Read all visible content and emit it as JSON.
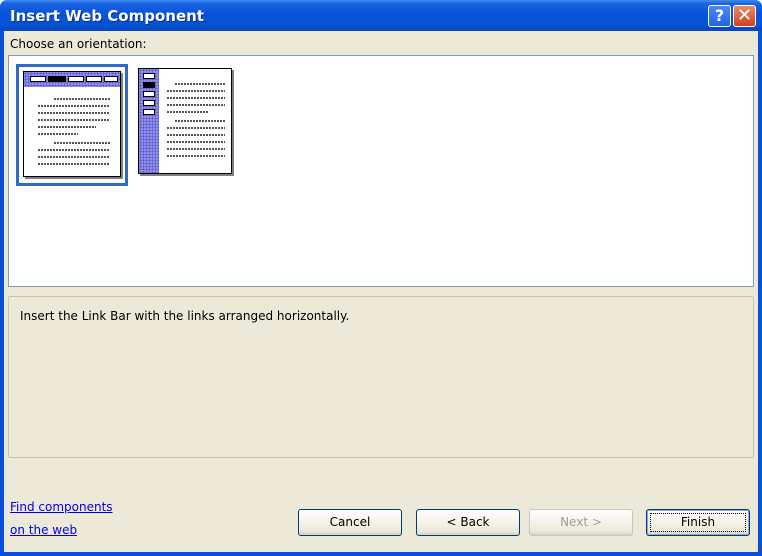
{
  "window": {
    "title": "Insert Web Component"
  },
  "titlebar_buttons": {
    "help": "?",
    "close": "✕"
  },
  "orientation": {
    "label": "Choose an orientation:",
    "selected": "horizontal",
    "options": [
      "horizontal",
      "vertical"
    ]
  },
  "description": "Insert the Link Bar with the links arranged horizontally.",
  "links": {
    "line1": "Find components",
    "line2": "on the web"
  },
  "buttons": {
    "cancel": "Cancel",
    "back": "< Back",
    "next": "Next >",
    "finish": "Finish"
  }
}
